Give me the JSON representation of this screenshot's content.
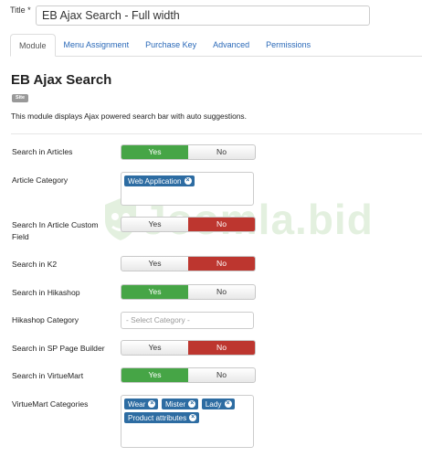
{
  "title": {
    "label": "Title *",
    "value": "EB Ajax Search - Full width"
  },
  "tabs": [
    {
      "label": "Module"
    },
    {
      "label": "Menu Assignment"
    },
    {
      "label": "Purchase Key"
    },
    {
      "label": "Advanced"
    },
    {
      "label": "Permissions"
    }
  ],
  "module": {
    "heading": "EB Ajax Search",
    "badge": "Site",
    "description": "This module displays Ajax powered search bar with auto suggestions."
  },
  "watermark": {
    "text": "Joomla.bid"
  },
  "fields": {
    "search_articles": {
      "label": "Search in Articles",
      "yes": "Yes",
      "no": "No",
      "value": "Yes"
    },
    "article_category": {
      "label": "Article Category",
      "chips": [
        "Web Application"
      ]
    },
    "search_article_custom_field": {
      "label": "Search In Article Custom Field",
      "yes": "Yes",
      "no": "No",
      "value": "No"
    },
    "search_k2": {
      "label": "Search in K2",
      "yes": "Yes",
      "no": "No",
      "value": "No"
    },
    "search_hikashop": {
      "label": "Search in Hikashop",
      "yes": "Yes",
      "no": "No",
      "value": "Yes"
    },
    "hikashop_category": {
      "label": "Hikashop Category",
      "placeholder": "- Select Category -"
    },
    "search_sp_page_builder": {
      "label": "Search in SP Page Builder",
      "yes": "Yes",
      "no": "No",
      "value": "No"
    },
    "search_virtuemart": {
      "label": "Search in VirtueMart",
      "yes": "Yes",
      "no": "No",
      "value": "Yes"
    },
    "virtuemart_categories": {
      "label": "VirtueMart Categories",
      "chips": [
        "Wear",
        "Mister",
        "Lady",
        "Product attributes"
      ]
    }
  }
}
